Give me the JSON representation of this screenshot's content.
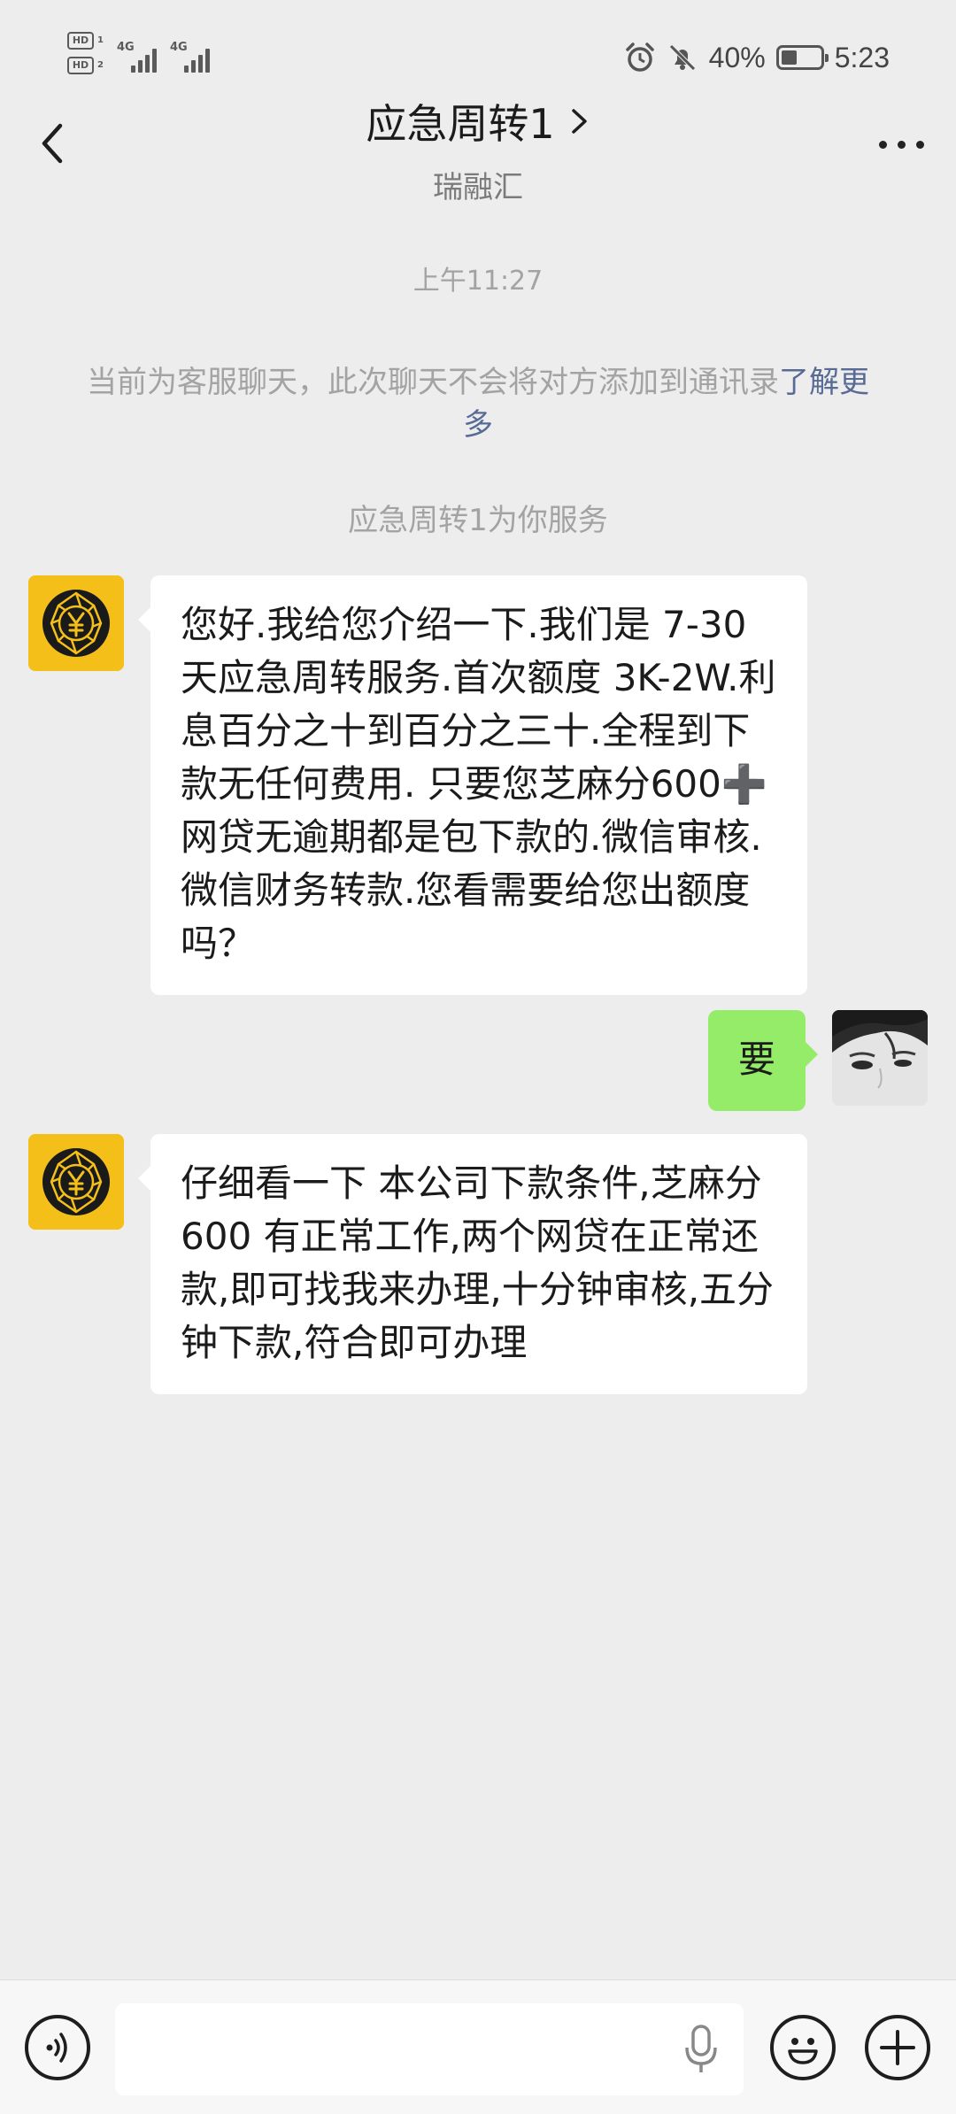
{
  "status_bar": {
    "hd1": "HD",
    "hd1_sub": "1",
    "hd2": "HD",
    "hd2_sub": "2",
    "net1": "4G",
    "net2": "4G",
    "battery_percent": "40%",
    "battery_level": 0.4,
    "time": "5:23",
    "icons": [
      "alarm-icon",
      "mute-bell-icon",
      "battery-icon"
    ]
  },
  "header": {
    "title": "应急周转1",
    "subtitle": "瑞融汇"
  },
  "chat": {
    "timestamp": "上午11:27",
    "notice_text": "当前为客服聊天，此次聊天不会将对方添加到通讯录",
    "notice_link": "了解更多",
    "service_note": "应急周转1为你服务",
    "messages": [
      {
        "sender": "bot",
        "text": "您好.我给您介绍一下.我们是 7-30天应急周转服务.首次额度 3K-2W.利息百分之十到百分之三十.全程到下款无任何费用. 只要您芝麻分600➕网贷无逾期都是包下款的.微信审核.微信财务转款.您看需要给您出额度吗？"
      },
      {
        "sender": "me",
        "text": "要"
      },
      {
        "sender": "bot",
        "text": "仔细看一下 本公司下款条件,芝麻分 600 有正常工作,两个网贷在正常还款,即可找我来办理,十分钟审核,五分钟下款,符合即可办理"
      }
    ]
  },
  "input_bar": {
    "value": "",
    "placeholder": ""
  },
  "colors": {
    "background": "#ededed",
    "bubble_in": "#ffffff",
    "bubble_out": "#95ec69",
    "link": "#576b95",
    "bot_avatar": "#f5bf1a"
  }
}
